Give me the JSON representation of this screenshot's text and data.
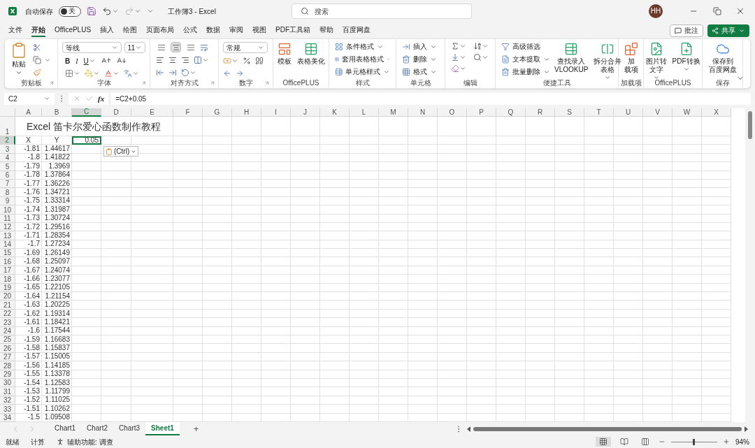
{
  "titlebar": {
    "autosave_label": "自动保存",
    "autosave_on": false,
    "autosave_state": "关",
    "title": "工作簿3 - Excel",
    "search_placeholder": "搜索",
    "avatar": "HH"
  },
  "menu": {
    "tabs": [
      {
        "label": "文件",
        "selected": false
      },
      {
        "label": "开始",
        "selected": true
      },
      {
        "label": "OfficePLUS",
        "selected": false
      },
      {
        "label": "插入",
        "selected": false
      },
      {
        "label": "绘图",
        "selected": false
      },
      {
        "label": "页面布局",
        "selected": false
      },
      {
        "label": "公式",
        "selected": false
      },
      {
        "label": "数据",
        "selected": false
      },
      {
        "label": "审阅",
        "selected": false
      },
      {
        "label": "视图",
        "selected": false
      },
      {
        "label": "PDF工具箱",
        "selected": false
      },
      {
        "label": "帮助",
        "selected": false
      },
      {
        "label": "百度网盘",
        "selected": false
      }
    ],
    "comment": "批注",
    "share": "共享"
  },
  "ribbon": {
    "groups": [
      {
        "kind": "clipboard",
        "label": "剪贴板",
        "launcher": true,
        "paste": "粘贴"
      },
      {
        "kind": "font",
        "label": "字体",
        "launcher": true,
        "font": "等线",
        "size": "11",
        "bold": "B",
        "italic": "I",
        "underline": "U"
      },
      {
        "kind": "alignment",
        "label": "对齐方式",
        "launcher": true,
        "vertical_align": [
          {
            "selected": false
          },
          {
            "selected": true
          },
          {
            "selected": false
          }
        ]
      },
      {
        "kind": "number",
        "label": "数字",
        "launcher": true,
        "format": "常规"
      },
      {
        "kind": "buttons",
        "label": "OfficePLUS",
        "launcher": false,
        "buttons": [
          {
            "lines": [
              "模板"
            ],
            "menu": false
          },
          {
            "lines": [
              "表格美化"
            ],
            "menu": false
          }
        ]
      },
      {
        "kind": "list",
        "label": "样式",
        "launcher": false,
        "items": [
          {
            "label": "条件格式",
            "menu": true
          },
          {
            "label": "套用表格格式",
            "menu": true
          },
          {
            "label": "单元格样式",
            "menu": true
          }
        ]
      },
      {
        "kind": "list",
        "label": "单元格",
        "launcher": false,
        "items": [
          {
            "label": "插入",
            "menu": true
          },
          {
            "label": "删除",
            "menu": true
          },
          {
            "label": "格式",
            "menu": true
          }
        ]
      },
      {
        "kind": "editing",
        "label": "编辑",
        "launcher": false
      },
      {
        "kind": "tools",
        "label": "便捷工具",
        "launcher": false,
        "items": [
          {
            "label": "高级筛选",
            "menu": false
          },
          {
            "label": "文本提取",
            "menu": true
          },
          {
            "label": "批量删除",
            "menu": true
          }
        ],
        "buttons": [
          {
            "lines": [
              "查找录入",
              "VLOOKUP"
            ],
            "menu": false
          },
          {
            "lines": [
              "拆分合并",
              "表格"
            ],
            "menu": true
          }
        ]
      },
      {
        "kind": "buttons",
        "label": "加载项",
        "launcher": false,
        "buttons": [
          {
            "lines": [
              "加",
              "载项"
            ],
            "menu": false
          }
        ]
      },
      {
        "kind": "buttons",
        "label": "OfficePLUS",
        "launcher": false,
        "buttons": [
          {
            "lines": [
              "图片转",
              "文字"
            ],
            "menu": true
          },
          {
            "lines": [
              "PDF转换"
            ],
            "menu": true
          }
        ]
      },
      {
        "kind": "buttons",
        "label": "保存",
        "launcher": false,
        "buttons": [
          {
            "lines": [
              "保存到",
              "百度网盘"
            ],
            "menu": false
          }
        ]
      }
    ]
  },
  "formula_bar": {
    "name_box": "C2",
    "function_button": "fx",
    "formula": "=C2+0.05"
  },
  "sheet": {
    "columns": [
      {
        "label": "A",
        "selected": false
      },
      {
        "label": "B",
        "selected": false
      },
      {
        "label": "C",
        "selected": true
      },
      {
        "label": "D",
        "selected": false
      },
      {
        "label": "E",
        "selected": false
      },
      {
        "label": "F",
        "selected": false
      },
      {
        "label": "G",
        "selected": false
      },
      {
        "label": "H",
        "selected": false
      },
      {
        "label": "I",
        "selected": false
      },
      {
        "label": "J",
        "selected": false
      },
      {
        "label": "K",
        "selected": false
      },
      {
        "label": "L",
        "selected": false
      },
      {
        "label": "M",
        "selected": false
      },
      {
        "label": "N",
        "selected": false
      },
      {
        "label": "O",
        "selected": false
      },
      {
        "label": "P",
        "selected": false
      },
      {
        "label": "Q",
        "selected": false
      },
      {
        "label": "R",
        "selected": false
      },
      {
        "label": "S",
        "selected": false
      },
      {
        "label": "T",
        "selected": false
      },
      {
        "label": "U",
        "selected": false
      },
      {
        "label": "V",
        "selected": false
      },
      {
        "label": "W",
        "selected": false
      },
      {
        "label": "X",
        "selected": false
      }
    ],
    "paste_options": "(Ctrl)",
    "rows": [
      {
        "number": "1",
        "kind": "title",
        "selected": false,
        "cells": [
          "Excel 笛卡尔爱心函数制作教程"
        ]
      },
      {
        "number": "2",
        "kind": "header",
        "selected": true,
        "cells": [
          "X",
          "Y",
          "0.05"
        ]
      },
      {
        "number": "3",
        "kind": "data",
        "selected": false,
        "cells": [
          "-1.81",
          "1.44617"
        ]
      },
      {
        "number": "4",
        "kind": "data",
        "selected": false,
        "cells": [
          "-1.8",
          "1.41822"
        ]
      },
      {
        "number": "5",
        "kind": "data",
        "selected": false,
        "cells": [
          "-1.79",
          "1.3969"
        ]
      },
      {
        "number": "6",
        "kind": "data",
        "selected": false,
        "cells": [
          "-1.78",
          "1.37864"
        ]
      },
      {
        "number": "7",
        "kind": "data",
        "selected": false,
        "cells": [
          "-1.77",
          "1.36226"
        ]
      },
      {
        "number": "8",
        "kind": "data",
        "selected": false,
        "cells": [
          "-1.76",
          "1.34721"
        ]
      },
      {
        "number": "9",
        "kind": "data",
        "selected": false,
        "cells": [
          "-1.75",
          "1.33314"
        ]
      },
      {
        "number": "10",
        "kind": "data",
        "selected": false,
        "cells": [
          "-1.74",
          "1.31987"
        ]
      },
      {
        "number": "11",
        "kind": "data",
        "selected": false,
        "cells": [
          "-1.73",
          "1.30724"
        ]
      },
      {
        "number": "12",
        "kind": "data",
        "selected": false,
        "cells": [
          "-1.72",
          "1.29516"
        ]
      },
      {
        "number": "13",
        "kind": "data",
        "selected": false,
        "cells": [
          "-1.71",
          "1.28354"
        ]
      },
      {
        "number": "14",
        "kind": "data",
        "selected": false,
        "cells": [
          "-1.7",
          "1.27234"
        ]
      },
      {
        "number": "15",
        "kind": "data",
        "selected": false,
        "cells": [
          "-1.69",
          "1.26149"
        ]
      },
      {
        "number": "16",
        "kind": "data",
        "selected": false,
        "cells": [
          "-1.68",
          "1.25097"
        ]
      },
      {
        "number": "17",
        "kind": "data",
        "selected": false,
        "cells": [
          "-1.67",
          "1.24074"
        ]
      },
      {
        "number": "18",
        "kind": "data",
        "selected": false,
        "cells": [
          "-1.66",
          "1.23077"
        ]
      },
      {
        "number": "19",
        "kind": "data",
        "selected": false,
        "cells": [
          "-1.65",
          "1.22105"
        ]
      },
      {
        "number": "20",
        "kind": "data",
        "selected": false,
        "cells": [
          "-1.64",
          "1.21154"
        ]
      },
      {
        "number": "21",
        "kind": "data",
        "selected": false,
        "cells": [
          "-1.63",
          "1.20225"
        ]
      },
      {
        "number": "22",
        "kind": "data",
        "selected": false,
        "cells": [
          "-1.62",
          "1.19314"
        ]
      },
      {
        "number": "23",
        "kind": "data",
        "selected": false,
        "cells": [
          "-1.61",
          "1.18421"
        ]
      },
      {
        "number": "24",
        "kind": "data",
        "selected": false,
        "cells": [
          "-1.6",
          "1.17544"
        ]
      },
      {
        "number": "25",
        "kind": "data",
        "selected": false,
        "cells": [
          "-1.59",
          "1.16683"
        ]
      },
      {
        "number": "26",
        "kind": "data",
        "selected": false,
        "cells": [
          "-1.58",
          "1.15837"
        ]
      },
      {
        "number": "27",
        "kind": "data",
        "selected": false,
        "cells": [
          "-1.57",
          "1.15005"
        ]
      },
      {
        "number": "28",
        "kind": "data",
        "selected": false,
        "cells": [
          "-1.56",
          "1.14185"
        ]
      },
      {
        "number": "29",
        "kind": "data",
        "selected": false,
        "cells": [
          "-1.55",
          "1.13378"
        ]
      },
      {
        "number": "30",
        "kind": "data",
        "selected": false,
        "cells": [
          "-1.54",
          "1.12583"
        ]
      },
      {
        "number": "31",
        "kind": "data",
        "selected": false,
        "cells": [
          "-1.53",
          "1.11799"
        ]
      },
      {
        "number": "32",
        "kind": "data",
        "selected": false,
        "cells": [
          "-1.52",
          "1.11025"
        ]
      },
      {
        "number": "33",
        "kind": "data",
        "selected": false,
        "cells": [
          "-1.51",
          "1.10262"
        ]
      },
      {
        "number": "34",
        "kind": "data",
        "selected": false,
        "cells": [
          "-1.5",
          "1.09508"
        ]
      }
    ]
  },
  "sheet_tabs": {
    "tabs": [
      {
        "label": "Chart1",
        "selected": false
      },
      {
        "label": "Chart2",
        "selected": false
      },
      {
        "label": "Chart3",
        "selected": false
      },
      {
        "label": "Sheet1",
        "selected": true
      }
    ],
    "add": "+"
  },
  "status_bar": {
    "ready": "就绪",
    "calculate": "计算",
    "accessibility": "辅助功能: 调查",
    "views": [
      {
        "selected": true
      },
      {
        "selected": false
      },
      {
        "selected": false
      }
    ],
    "zoom": {
      "level": 0.49,
      "reading": "94%"
    }
  }
}
